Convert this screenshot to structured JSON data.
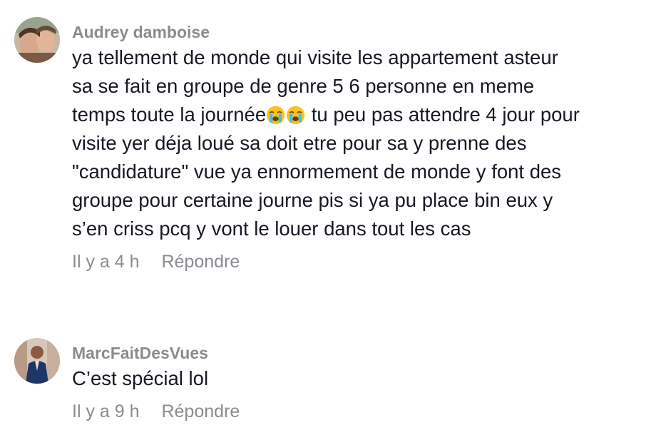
{
  "comments": [
    {
      "username": "Audrey damboise",
      "lines": [
        "ya tellement de monde qui visite les appartement asteur",
        "sa se fait en groupe de genre 5 6 personne en meme",
        [
          "temps toute la journée",
          " tu peu pas attendre 4 jour pour"
        ],
        "visite yer déja loué sa doit etre pour sa y prenne des",
        "\"candidature\" vue ya ennormement de monde y font des",
        "groupe pour certaine journe pis si ya pu place bin eux y",
        "s’en criss pcq y vont le louer dans tout les cas"
      ],
      "emoji": "loudly-crying-face-emoji",
      "time": "Il y a 4 h",
      "reply_label": "Répondre"
    },
    {
      "username": "MarcFaitDesVues",
      "text": "C’est spécial lol",
      "time": "Il y a 9 h",
      "reply_label": "Répondre"
    }
  ],
  "colors": {
    "username": "#8a8b91",
    "text": "#161823",
    "meta": "#8a8b91"
  }
}
